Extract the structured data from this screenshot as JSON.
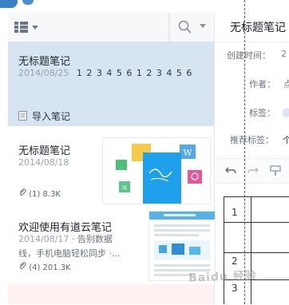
{
  "left": {
    "toolbar": {
      "view_icon": "list-view-icon",
      "search_icon": "search-icon"
    },
    "notes": [
      {
        "title": "无标题笔记",
        "date": "2014/08/25",
        "snippet": "1 2 3 4 5 6 1 2 3 4 5 6",
        "action": "导入笔记"
      },
      {
        "title": "无标题笔记",
        "date": "2014/08/18",
        "attachment": "(1) 8.3K"
      },
      {
        "title": "欢迎使用有道云笔记",
        "date": "2014/08/17",
        "snippet_line1": "· 告别数据",
        "snippet_line2": "线，手机电脑轻松同步 ·...",
        "attachment": "(4) 201.3K"
      }
    ]
  },
  "right": {
    "title": "无标题笔记",
    "created_label": "创建时间：",
    "created_value": "2",
    "author_label": "作者：",
    "author_value": "点",
    "tags_label": "标签：",
    "rec_tags_label": "推荐标签：",
    "rec_tags_value": "个",
    "table_rows": [
      "1",
      "",
      "2",
      "3"
    ]
  },
  "watermark": "Baidu 经验",
  "colors": {
    "selected_bg": "#d7e5f3",
    "accent": "#3b82c4"
  }
}
